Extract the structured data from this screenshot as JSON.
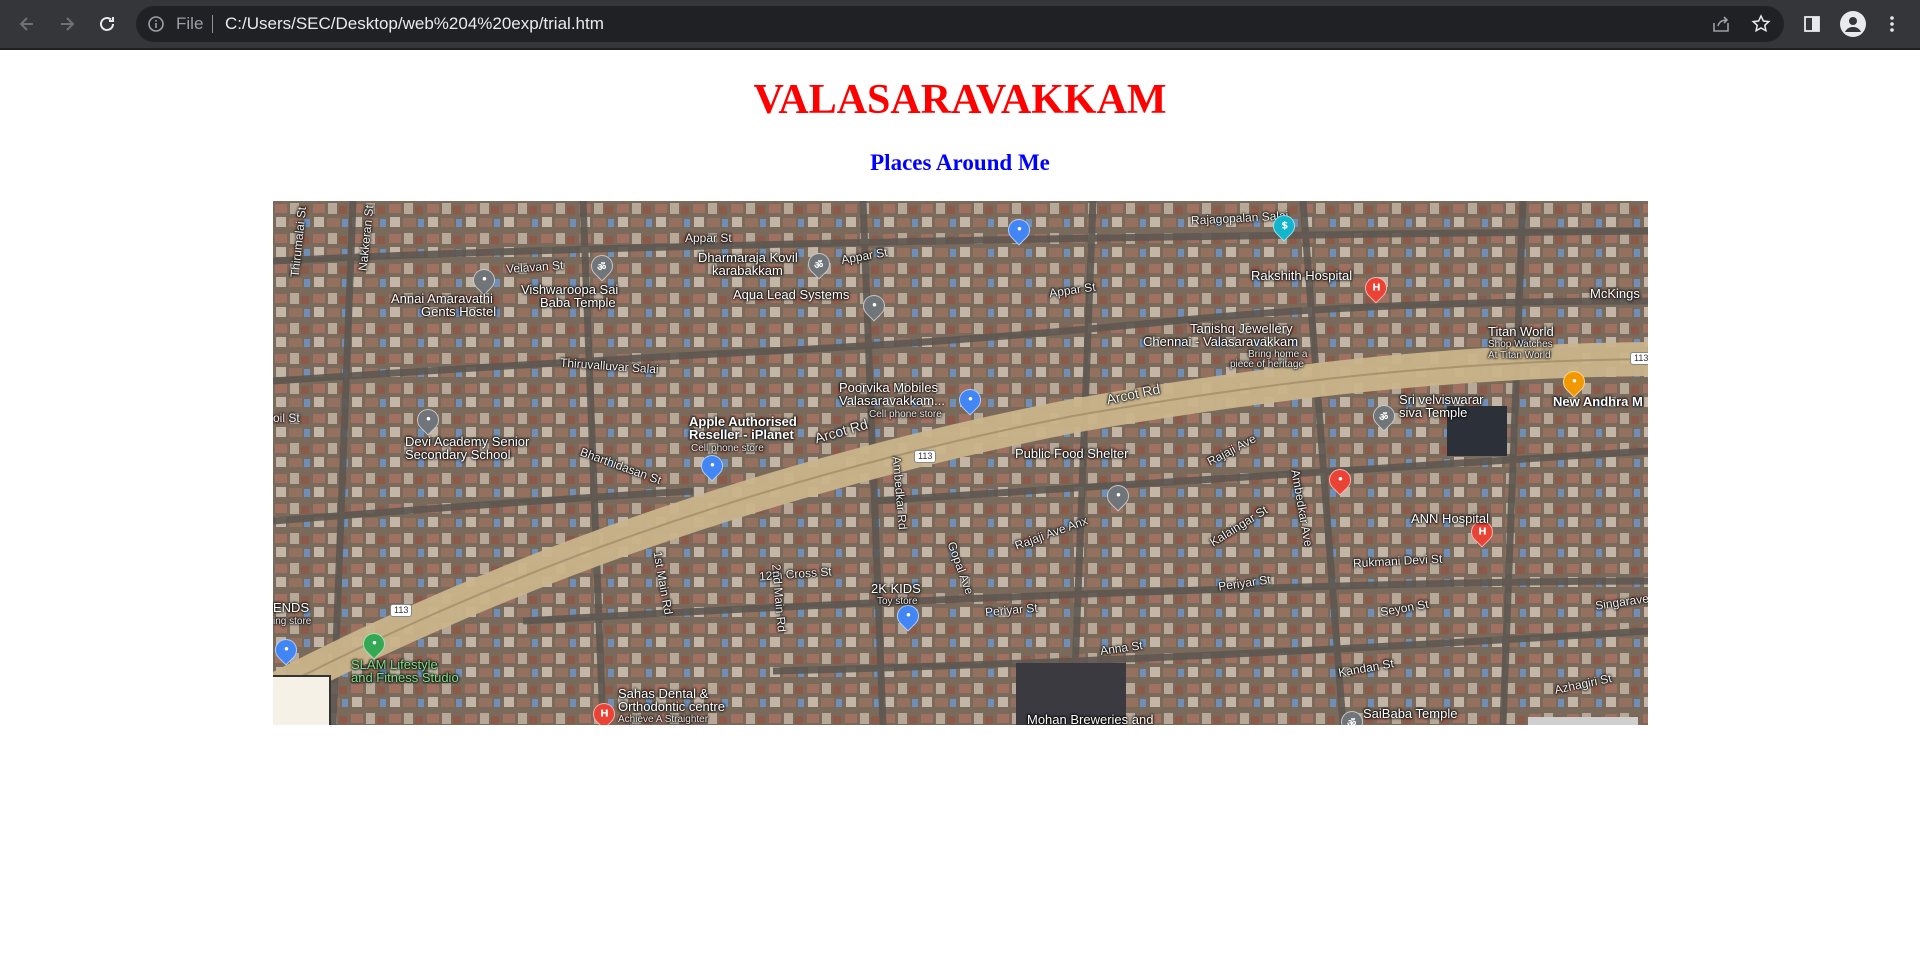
{
  "browser": {
    "scheme_label": "File",
    "url": "C:/Users/SEC/Desktop/web%204%20exp/trial.htm",
    "icons": [
      "back-arrow-icon",
      "forward-arrow-icon",
      "reload-icon",
      "info-icon",
      "share-icon",
      "star-icon",
      "side-panel-icon",
      "profile-icon",
      "menu-icon"
    ],
    "toolbar_bg": "#35363a",
    "omnibox_bg": "#202124"
  },
  "page": {
    "title": "VALASARAVAKKAM",
    "title_color": "#ff0000",
    "subtitle": "Places Around Me",
    "subtitle_color": "#0000ff"
  },
  "map": {
    "places": [
      {
        "name": "Annai Amaravathi Gents Hostel",
        "line1": "Annai Amaravathi",
        "line2": "Gents Hostel"
      },
      {
        "name": "Vishwaroopa Sai Baba Temple",
        "line1": "Vishwaroopa Sai",
        "line2": "Baba Temple"
      },
      {
        "name": "Dharmaraja Kovil",
        "line1": "Dharmaraja Kovil",
        "line2": "karabakkam"
      },
      {
        "name": "Aqua Lead Systems",
        "line1": "Aqua Lead Systems"
      },
      {
        "name": "Rakshith Hospital",
        "line1": "Rakshith Hospital"
      },
      {
        "name": "Tanishq Jewellery",
        "line1": "Tanishq Jewellery",
        "line2": "Chennai - Valasaravakkam",
        "line3": "Bring home a",
        "line4": "piece of heritage"
      },
      {
        "name": "Titan World",
        "line1": "Titan World",
        "line2": "Shop Watches",
        "line3": "At Titan World"
      },
      {
        "name": "New Andhra M",
        "line1": "New Andhra M"
      },
      {
        "name": "McKings",
        "line1": "McKings"
      },
      {
        "name": "Poorvika Mobiles",
        "line1": "Poorvika Mobiles",
        "line2": "Valasaravakkam...",
        "line3": "Cell phone store"
      },
      {
        "name": "Apple Authorised Reseller - iPlanet",
        "line1": "Apple Authorised",
        "line2": "Reseller - iPlanet",
        "line3": "Cell phone store"
      },
      {
        "name": "Sri velviswarar siva Temple",
        "line1": "Sri velviswarar",
        "line2": "siva Temple"
      },
      {
        "name": "Devi Academy Senior Secondary School",
        "line1": "Devi Academy Senior",
        "line2": "Secondary School"
      },
      {
        "name": "Public Food Shelter",
        "line1": "Public Food Shelter"
      },
      {
        "name": "ANN Hospital",
        "line1": "ANN Hospital"
      },
      {
        "name": "2K KIDS",
        "line1": "2K KIDS",
        "line2": "Toy store"
      },
      {
        "name": "SLAM Lifestyle and Fitness Studio",
        "line1": "SLAM Lifestyle",
        "line2": "and Fitness Studio"
      },
      {
        "name": "Sahas Dental & Orthodontic centre",
        "line1": "Sahas Dental &",
        "line2": "Orthodontic centre",
        "line3": "Achieve A Straighter"
      },
      {
        "name": "Mohan Breweries and",
        "line1": "Mohan Breweries and"
      },
      {
        "name": "SaiBaba Temple",
        "line1": "SaiBaba Temple"
      },
      {
        "name": "ENDS",
        "line1": "ENDS",
        "line2": "ing store"
      }
    ],
    "roads": {
      "arcot_rd_1": "Arcot Rd",
      "arcot_rd_2": "Arcot Rd",
      "appar_st_1": "Appar St",
      "appar_st_2": "Appar St",
      "appar_st_3": "Appar St",
      "velavan_st": "Velavan St",
      "thiruvalluvar_salai": "Thiruvalluvar Salai",
      "bharathidasan_st": "Bharthidasan St",
      "rajagopalan_salai": "Rajagopalan Salai",
      "rajaji_ave": "Rajaji Ave",
      "rajaji_ave_anx": "Rajaji Ave Anx",
      "kalaingar_st": "Kalaingar St",
      "ambedkar_ave": "Ambedkar Ave",
      "ambedkar_rd": "Ambedkar Rd",
      "gopal_ave": "Gopal Ave",
      "periyar_st_1": "Periyar St",
      "periyar_st_2": "Periyar St",
      "rukmani_devi_st": "Rukmani Devi St",
      "seyon_st": "Seyon St",
      "anna_st": "Anna St",
      "kandan_st": "Kandan St",
      "azhagiri_st": "Azhagiri St",
      "singaravelar": "Singarave",
      "twelfth_cross_st": "12th Cross St",
      "first_main_rd": "1st Main Rd",
      "second_main_rd": "2nd Main Rd",
      "thirumalai_st": "Thirumalai St",
      "nakkeran_st": "Nakkeran St",
      "oil_st": "oil St",
      "route_113_a": "113",
      "route_113_b": "113",
      "route_113_c": "113"
    },
    "colors": {
      "arcot_road": "#c9b48a",
      "pin_red": "#ea4335",
      "pin_blue": "#4285f4",
      "pin_green": "#34a853",
      "pin_orange": "#f29900",
      "pin_teal": "#12b5cb",
      "pin_gray": "#70757a"
    }
  }
}
